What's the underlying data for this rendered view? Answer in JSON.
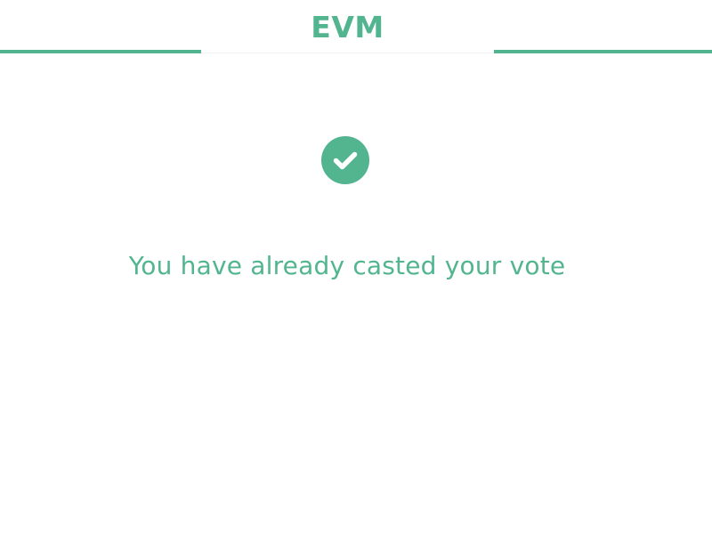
{
  "header": {
    "brand": "EVM"
  },
  "status": {
    "icon": "check-circle-icon",
    "message": "You have already casted your vote"
  },
  "colors": {
    "accent": "#52b58f",
    "background": "#ffffff"
  }
}
